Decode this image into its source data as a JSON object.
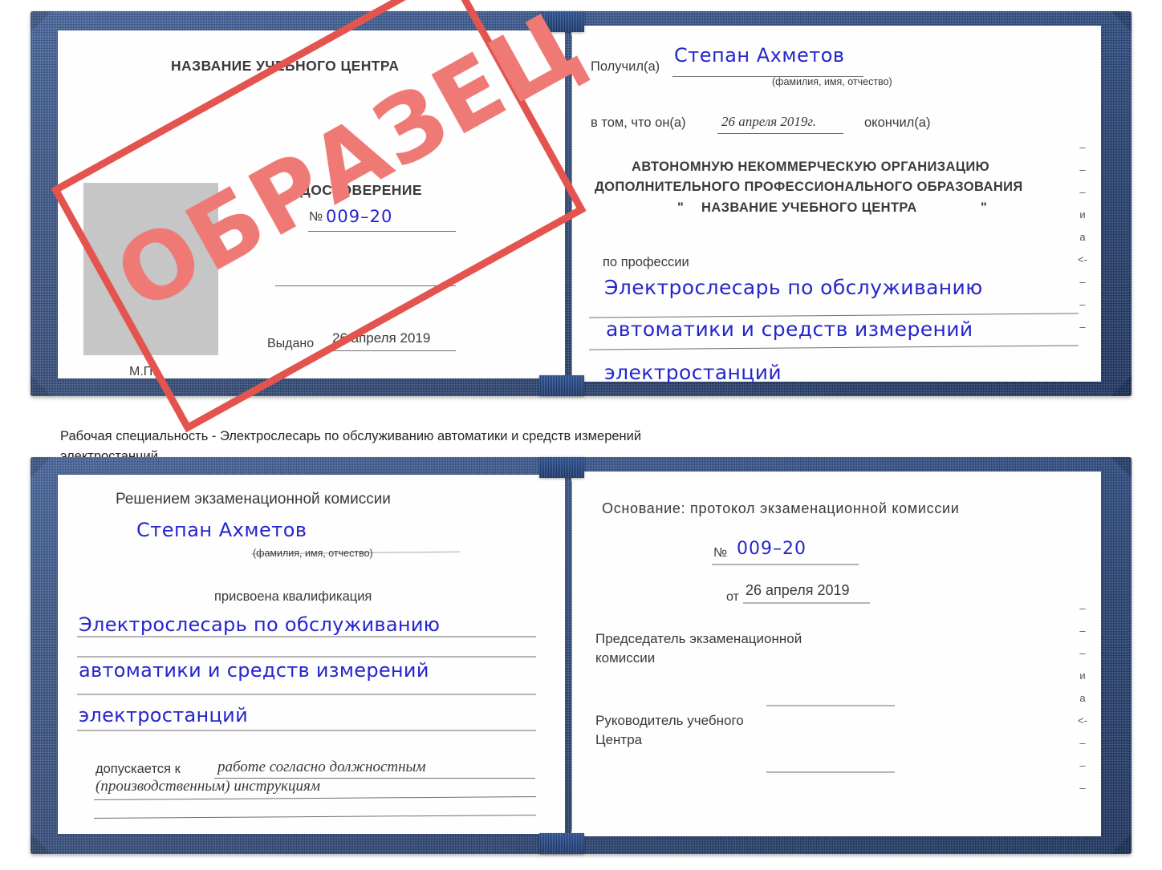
{
  "document": {
    "type": "certificate-scan",
    "language": "ru",
    "watermark": "ОБРАЗЕЦ"
  },
  "caption": {
    "line1": "Рабочая специальность - Электрослесарь по обслуживанию автоматики и средств измерений",
    "line2": "электростанций"
  },
  "certificate_top": {
    "left_page": {
      "center_name": "НАЗВАНИЕ УЧЕБНОГО ЦЕНТРА",
      "title": "УДОСТОВЕРЕНИЕ",
      "number_label": "№",
      "number_value": "009–20",
      "issued_label": "Выдано",
      "issued_value": "26 апреля 2019",
      "seal_label": "М.П."
    },
    "right_page": {
      "received_label": "Получил(а)",
      "received_value": "Степан Ахметов",
      "fio_hint": "(фамилия, имя, отчество)",
      "that_he_label": "в том, что он(а)",
      "that_he_value": "26 апреля 2019г.",
      "finished_label": "окончил(а)",
      "org_line1": "АВТОНОМНУЮ НЕКОММЕРЧЕСКУЮ ОРГАНИЗАЦИЮ",
      "org_line2": "ДОПОЛНИТЕЛЬНОГО ПРОФЕССИОНАЛЬНОГО ОБРАЗОВАНИЯ",
      "org_line3_quote_open": "\"",
      "org_line3": "НАЗВАНИЕ УЧЕБНОГО ЦЕНТРА",
      "org_line3_quote_close": "\"",
      "profession_label": "по профессии",
      "profession_line1": "Электрослесарь по обслуживанию",
      "profession_line2": "автоматики и средств измерений",
      "profession_line3": "электростанций",
      "edge_column": [
        "–",
        "–",
        "–",
        "и",
        "а",
        "<-",
        "–",
        "–",
        "–",
        "–"
      ]
    }
  },
  "certificate_bottom": {
    "left_page": {
      "heading": "Решением экзаменационной комиссии",
      "name_value": "Степан Ахметов",
      "fio_hint": "(фамилия, имя, отчество)",
      "qualification_label": "присвоена квалификация",
      "qualification_line1": "Электрослесарь по обслуживанию",
      "qualification_line2": "автоматики и средств измерений",
      "qualification_line3": "электростанций",
      "admitted_label": "допускается к",
      "admitted_line1": "работе согласно должностным",
      "admitted_line2": "(производственным) инструкциям"
    },
    "right_page": {
      "basis_label": "Основание: протокол экзаменационной комиссии",
      "number_label": "№",
      "number_value": "009–20",
      "date_label": "от",
      "date_value": "26 апреля 2019",
      "chairman_line1": "Председатель экзаменационной",
      "chairman_line2": "комиссии",
      "head_line1": "Руководитель учебного",
      "head_line2": "Центра",
      "edge_column": [
        "–",
        "–",
        "–",
        "и",
        "а",
        "<-",
        "–",
        "–",
        "–",
        "–"
      ]
    }
  },
  "colors": {
    "cover_blue": "#24457f",
    "handwriting_blue": "#2526cc",
    "stamp_red": "#e4544f",
    "stamp_text_red": "#ef7a75",
    "photo_grey": "#c6c6c6",
    "text_grey": "#3a3a3a"
  }
}
